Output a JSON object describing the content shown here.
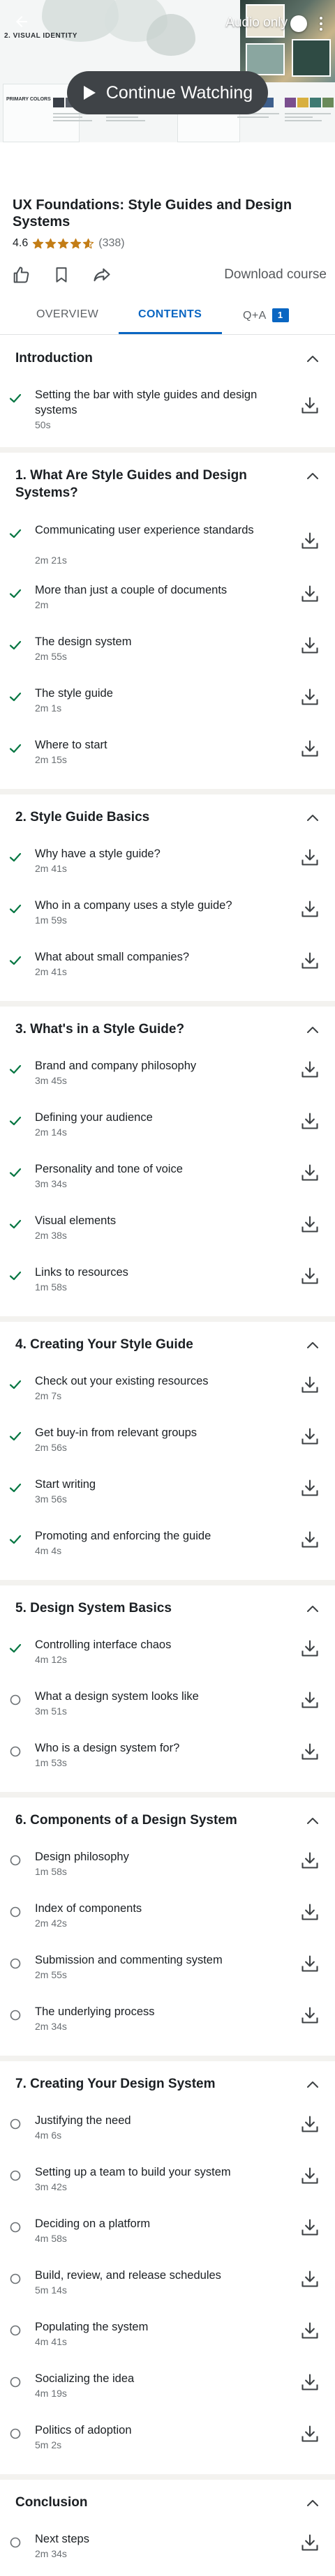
{
  "hero": {
    "section_label": "2. VISUAL IDENTITY",
    "audio_only_label": "Audio only",
    "continue_label": "Continue Watching"
  },
  "course": {
    "title": "UX Foundations: Style Guides and Design Systems",
    "rating": "4.6",
    "rating_count": "(338)",
    "stars_value": 4.6,
    "download_label": "Download course"
  },
  "tabs": [
    {
      "label": "OVERVIEW"
    },
    {
      "label": "CONTENTS"
    },
    {
      "label": "Q+A",
      "badge": "1"
    }
  ],
  "colors": {
    "accent": "#0a66c2",
    "completed_check": "#057642",
    "star": "#c37d16",
    "text_primary": "#1b1f23",
    "text_secondary": "#6a6f73"
  },
  "sections": [
    {
      "title": "Introduction",
      "items": [
        {
          "title": "Setting the bar with style guides and design systems",
          "duration": "50s",
          "done": true
        }
      ]
    },
    {
      "title": "1. What Are Style Guides and Design Systems?",
      "items": [
        {
          "title": "Communicating user experience standards",
          "duration": "2m 21s",
          "done": true
        },
        {
          "title": "More than just a couple of documents",
          "duration": "2m",
          "done": true
        },
        {
          "title": "The design system",
          "duration": "2m 55s",
          "done": true
        },
        {
          "title": "The style guide",
          "duration": "2m 1s",
          "done": true
        },
        {
          "title": "Where to start",
          "duration": "2m 15s",
          "done": true
        }
      ]
    },
    {
      "title": "2. Style Guide Basics",
      "items": [
        {
          "title": "Why have a style guide?",
          "duration": "2m 41s",
          "done": true
        },
        {
          "title": "Who in a company uses a style guide?",
          "duration": "1m 59s",
          "done": true
        },
        {
          "title": "What about small companies?",
          "duration": "2m 41s",
          "done": true
        }
      ]
    },
    {
      "title": "3. What's in a Style Guide?",
      "items": [
        {
          "title": "Brand and company philosophy",
          "duration": "3m 45s",
          "done": true
        },
        {
          "title": "Defining your audience",
          "duration": "2m 14s",
          "done": true
        },
        {
          "title": "Personality and tone of voice",
          "duration": "3m 34s",
          "done": true
        },
        {
          "title": "Visual elements",
          "duration": "2m 38s",
          "done": true
        },
        {
          "title": "Links to resources",
          "duration": "1m 58s",
          "done": true
        }
      ]
    },
    {
      "title": "4. Creating Your Style Guide",
      "items": [
        {
          "title": "Check out your existing resources",
          "duration": "2m 7s",
          "done": true
        },
        {
          "title": "Get buy-in from relevant groups",
          "duration": "2m 56s",
          "done": true
        },
        {
          "title": "Start writing",
          "duration": "3m 56s",
          "done": true
        },
        {
          "title": "Promoting and enforcing the guide",
          "duration": "4m 4s",
          "done": true
        }
      ]
    },
    {
      "title": "5. Design System Basics",
      "items": [
        {
          "title": "Controlling interface chaos",
          "duration": "4m 12s",
          "done": true
        },
        {
          "title": "What a design system looks like",
          "duration": "3m 51s",
          "done": false
        },
        {
          "title": "Who is a design system for?",
          "duration": "1m 53s",
          "done": false
        }
      ]
    },
    {
      "title": "6. Components of a Design System",
      "items": [
        {
          "title": "Design philosophy",
          "duration": "1m 58s",
          "done": false
        },
        {
          "title": "Index of components",
          "duration": "2m 42s",
          "done": false
        },
        {
          "title": "Submission and commenting system",
          "duration": "2m 55s",
          "done": false
        },
        {
          "title": "The underlying process",
          "duration": "2m 34s",
          "done": false
        }
      ]
    },
    {
      "title": "7. Creating Your Design System",
      "items": [
        {
          "title": "Justifying the need",
          "duration": "4m 6s",
          "done": false
        },
        {
          "title": "Setting up a team to build your system",
          "duration": "3m 42s",
          "done": false
        },
        {
          "title": "Deciding on a platform",
          "duration": "4m 58s",
          "done": false
        },
        {
          "title": "Build, review, and release schedules",
          "duration": "5m 14s",
          "done": false
        },
        {
          "title": "Populating the system",
          "duration": "4m 41s",
          "done": false
        },
        {
          "title": "Socializing the idea",
          "duration": "4m 19s",
          "done": false
        },
        {
          "title": "Politics of adoption",
          "duration": "5m 2s",
          "done": false
        }
      ]
    },
    {
      "title": "Conclusion",
      "items": [
        {
          "title": "Next steps",
          "duration": "2m 34s",
          "done": false
        }
      ]
    }
  ]
}
